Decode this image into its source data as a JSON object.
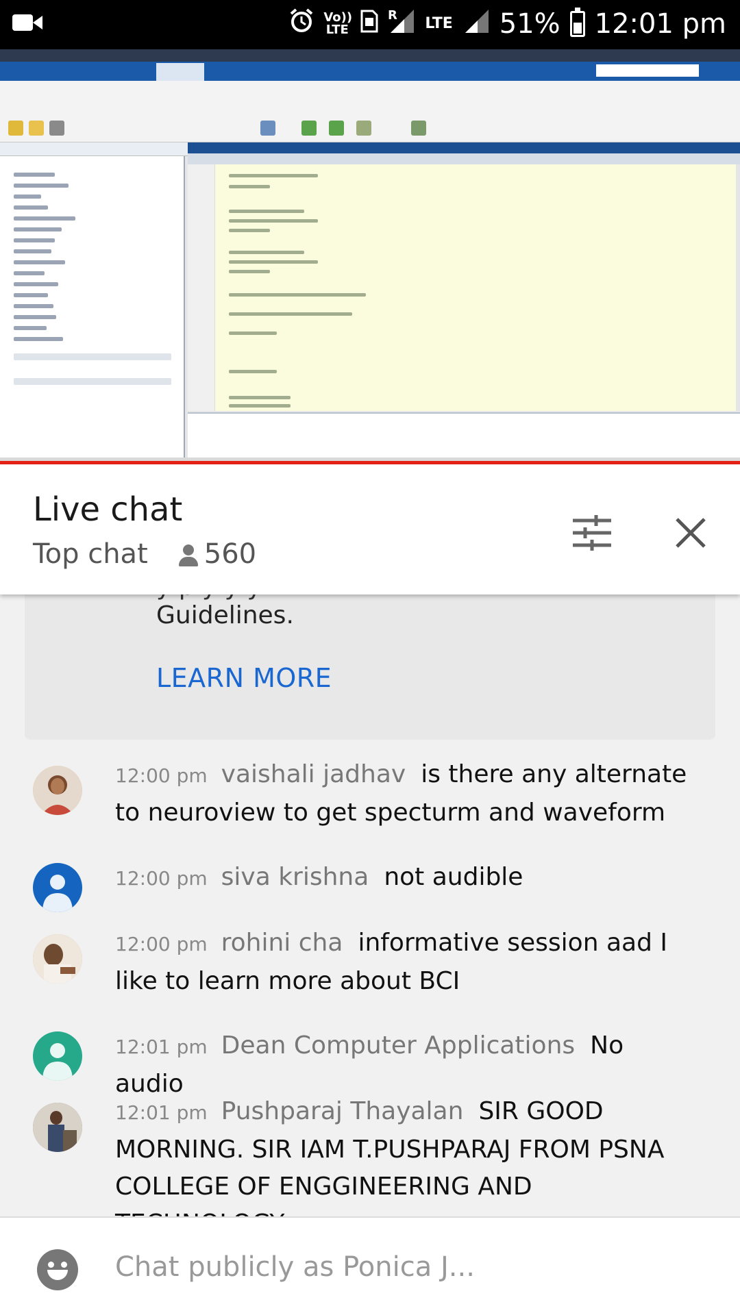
{
  "status_bar": {
    "signal_type": "Vo)) LTE",
    "roaming": "R",
    "network": "LTE",
    "battery": "51%",
    "battery_level": 0.51,
    "time": "12:01 pm"
  },
  "video": {
    "progress": 1.0,
    "accent": "#e62117"
  },
  "header": {
    "title": "Live chat",
    "mode": "Top chat",
    "viewers": "560"
  },
  "notice": {
    "text": "Guidelines.",
    "link": "LEARN MORE"
  },
  "messages": [
    {
      "time": "12:00 pm",
      "author": "vaishali jadhav",
      "text": "is there any alternate to neuroview to get specturm and waveform",
      "avatar": "photo"
    },
    {
      "time": "12:00 pm",
      "author": "siva krishna",
      "text": "not audible",
      "avatar": "default",
      "avatar_color": "#1565c0"
    },
    {
      "time": "12:00 pm",
      "author": "rohini cha",
      "text": "informative session aad I like to learn more about BCI",
      "avatar": "photo"
    },
    {
      "time": "12:01 pm",
      "author": "Dean Computer Applications",
      "text": "No audio",
      "avatar": "default",
      "avatar_color": "#26a98b"
    },
    {
      "time": "12:01 pm",
      "author": "Pushparaj Thayalan",
      "text": "SIR GOOD MORNING. SIR IAM T.PUSHPARAJ FROM PSNA COLLEGE OF ENGGINEERING AND TECHNOLOGY.",
      "avatar": "photo"
    }
  ],
  "input": {
    "placeholder": "Chat publicly as Ponica J..."
  }
}
